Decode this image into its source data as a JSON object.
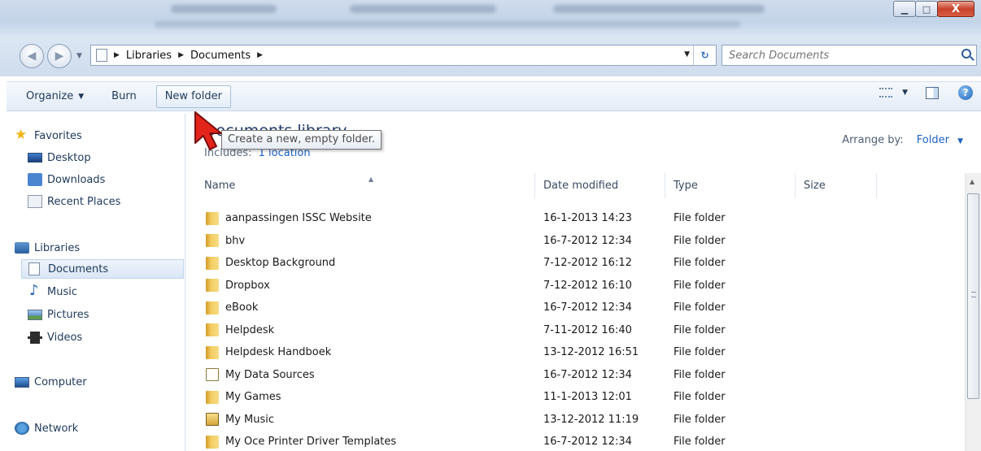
{
  "window": {
    "minimize_glyph": "▁",
    "maximize_glyph": "□",
    "close_glyph": "X"
  },
  "address": {
    "breadcrumbs": [
      "Libraries",
      "Documents"
    ],
    "search_placeholder": "Search Documents"
  },
  "toolbar": {
    "organize_label": "Organize",
    "burn_label": "Burn",
    "new_folder_label": "New folder",
    "tooltip": "Create a new, empty folder."
  },
  "sidebar": {
    "favorites": "Favorites",
    "desktop": "Desktop",
    "downloads": "Downloads",
    "recent_places": "Recent Places",
    "libraries": "Libraries",
    "documents": "Documents",
    "music": "Music",
    "pictures": "Pictures",
    "videos": "Videos",
    "computer": "Computer",
    "network": "Network"
  },
  "content": {
    "library_title": "Documents library",
    "includes_label": "Includes:",
    "includes_link": "1 location",
    "arrange_label": "Arrange by:",
    "arrange_value": "Folder",
    "columns": {
      "name": "Name",
      "date": "Date modified",
      "type": "Type",
      "size": "Size"
    },
    "files": [
      {
        "name": "aanpassingen ISSC Website",
        "date": "16-1-2013 14:23",
        "type": "File folder",
        "icon": "folder"
      },
      {
        "name": "bhv",
        "date": "16-7-2012 12:34",
        "type": "File folder",
        "icon": "folder"
      },
      {
        "name": "Desktop Background",
        "date": "7-12-2012 16:12",
        "type": "File folder",
        "icon": "folder"
      },
      {
        "name": "Dropbox",
        "date": "7-12-2012 16:10",
        "type": "File folder",
        "icon": "folder"
      },
      {
        "name": "eBook",
        "date": "16-7-2012 12:34",
        "type": "File folder",
        "icon": "folder"
      },
      {
        "name": "Helpdesk",
        "date": "7-11-2012 16:40",
        "type": "File folder",
        "icon": "folder"
      },
      {
        "name": "Helpdesk Handboek",
        "date": "13-12-2012 16:51",
        "type": "File folder",
        "icon": "folder"
      },
      {
        "name": "My Data Sources",
        "date": "16-7-2012 12:34",
        "type": "File folder",
        "icon": "data-sources-folder"
      },
      {
        "name": "My Games",
        "date": "11-1-2013 12:01",
        "type": "File folder",
        "icon": "folder"
      },
      {
        "name": "My Music",
        "date": "13-12-2012 11:19",
        "type": "File folder",
        "icon": "music-folder"
      },
      {
        "name": "My Oce Printer Driver Templates",
        "date": "16-7-2012 12:34",
        "type": "File folder",
        "icon": "folder"
      }
    ]
  }
}
